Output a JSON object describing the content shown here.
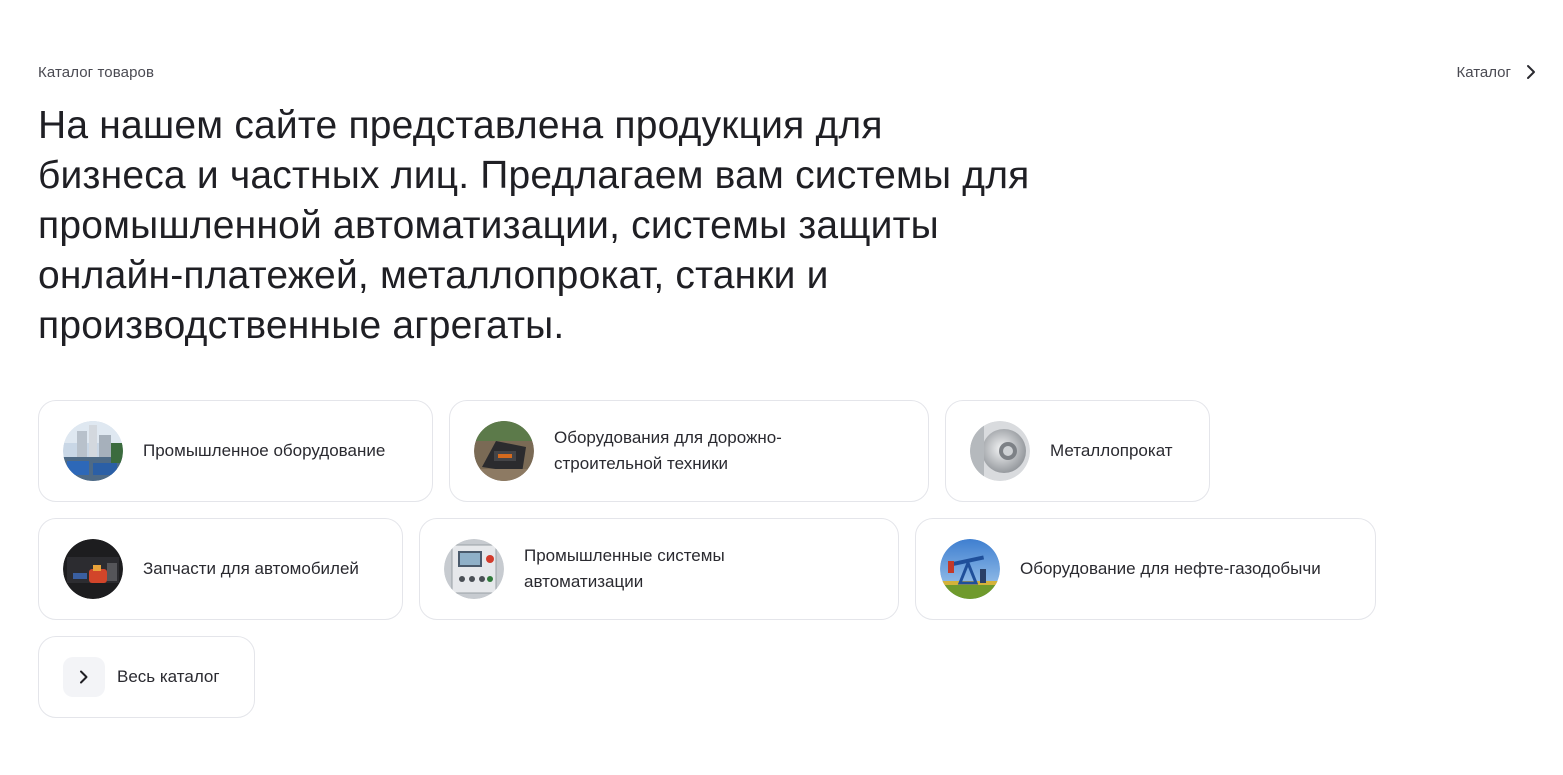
{
  "header": {
    "section_label": "Каталог товаров",
    "catalog_link": "Каталог",
    "headline": "На нашем сайте представлена продукция для бизнеса и частных лиц. Предлагаем вам системы для промышленной автоматизации, системы защиты онлайн-платежей, металлопрокат, станки и производственные агрегаты."
  },
  "categories": [
    {
      "label": "Промышленное оборудование",
      "icon": "industrial-plant-icon"
    },
    {
      "label": "Оборудования для дорожно-строительной техники",
      "icon": "road-machinery-icon"
    },
    {
      "label": "Металлопрокат",
      "icon": "metal-roll-icon"
    },
    {
      "label": "Запчасти для автомобилей",
      "icon": "car-parts-icon"
    },
    {
      "label": "Промышленные системы автоматизации",
      "icon": "control-panel-icon"
    },
    {
      "label": "Оборудование для нефте-газодобычи",
      "icon": "oil-pump-icon"
    }
  ],
  "all_catalog": {
    "label": "Весь каталог",
    "icon": "chevron-right-icon"
  }
}
